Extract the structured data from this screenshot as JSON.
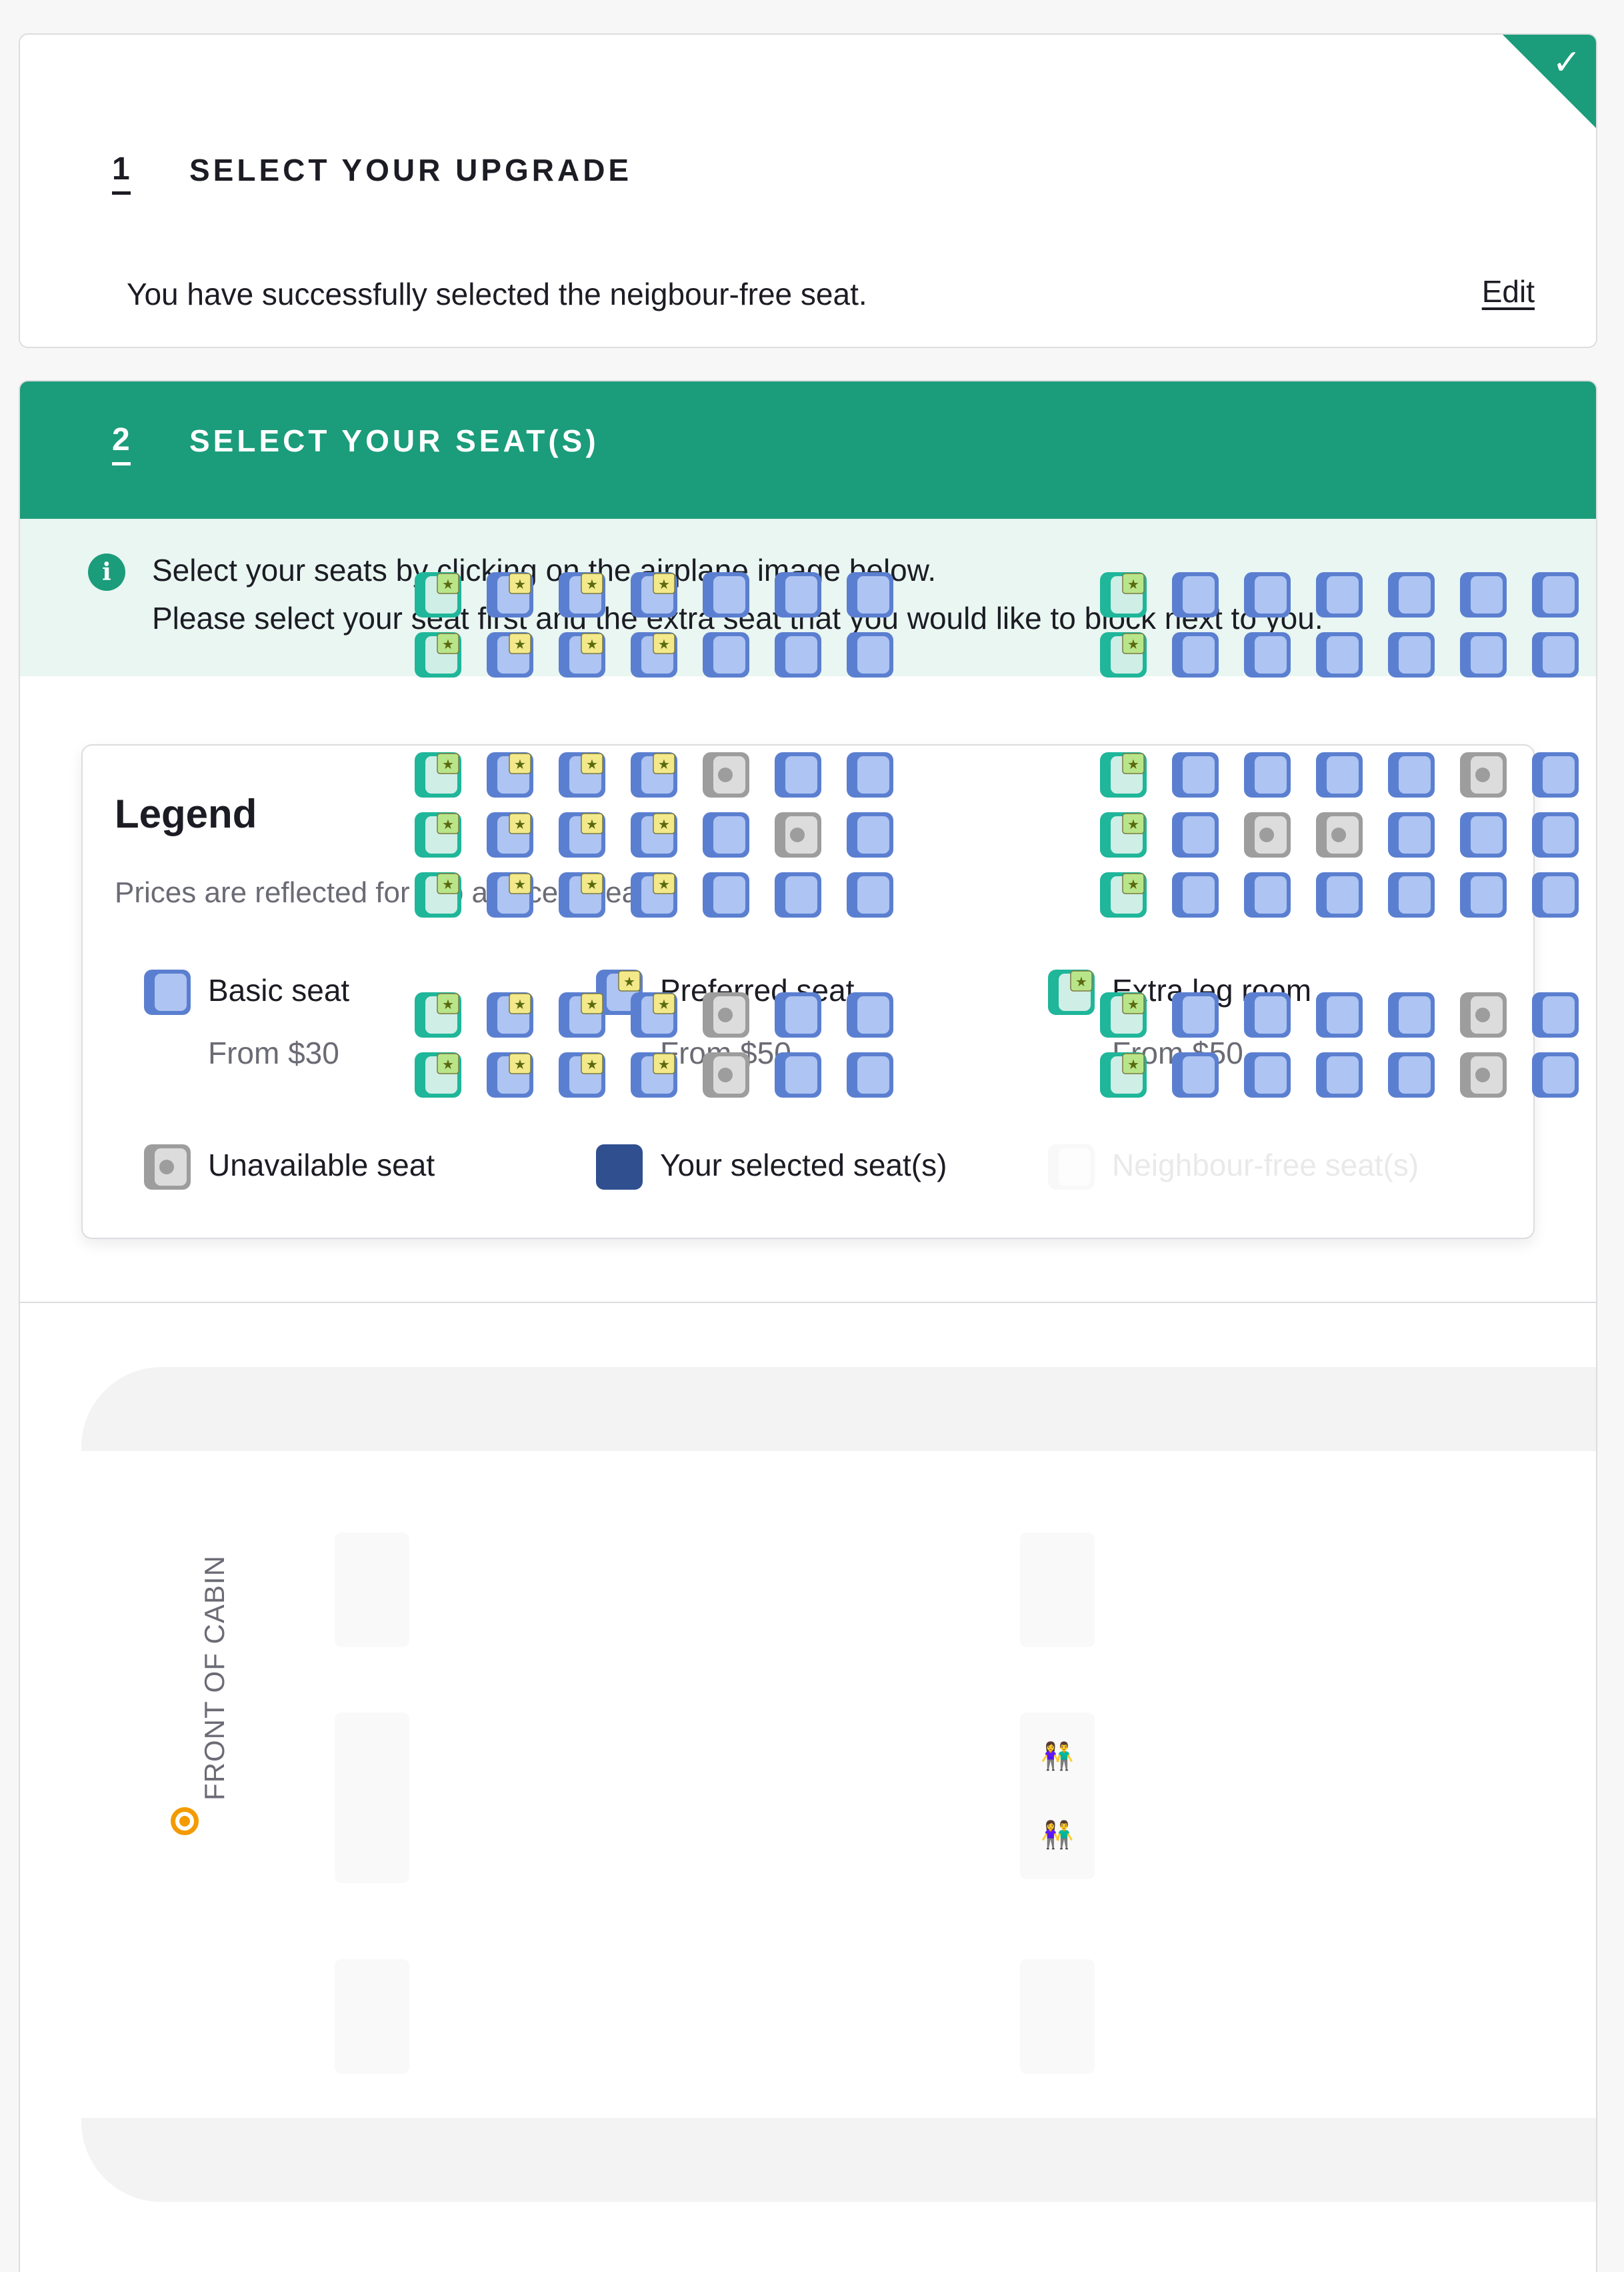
{
  "step1": {
    "number": "1",
    "title": "SELECT YOUR UPGRADE",
    "message": "You have successfully selected the neigbour-free seat.",
    "edit_label": "Edit",
    "status_icon": "check-icon"
  },
  "step2": {
    "number": "2",
    "title": "SELECT YOUR SEAT(S)",
    "info_icon": "info-icon",
    "info_line1": "Select your seats by clicking on the airplane image below.",
    "info_line2": "Please select your seat first and the extra seat that you would like to block next to you."
  },
  "legend": {
    "title": "Legend",
    "note": "Prices are reflected for two adjacent seats.",
    "items": [
      {
        "type": "basic",
        "label": "Basic seat",
        "price": "From $30"
      },
      {
        "type": "preferred",
        "label": "Preferred seat",
        "price": "From $50"
      },
      {
        "type": "extra",
        "label": "Extra leg room",
        "price": "From $50"
      },
      {
        "type": "unavailable",
        "label": "Unavailable seat",
        "price": ""
      },
      {
        "type": "selected",
        "label": "Your selected seat(s)",
        "price": ""
      },
      {
        "type": "neighbour",
        "label": "Neighbour-free seat(s)",
        "price": ""
      }
    ]
  },
  "cabin": {
    "front_label": "FRONT OF CABIN",
    "lavatory_icon": "lavatory-icon",
    "colors": {
      "basic": "#5b7fd0",
      "basic_light": "#aec4f2",
      "preferred_badge": "#f3e98a",
      "extra_teal": "#1fb69a",
      "extra_light": "#cfeee6",
      "extra_badge": "#b9e58a",
      "unavailable": "#9d9d9d",
      "unavailable_light": "#dcdcdc",
      "selected": "#2f4f8f"
    },
    "left_section": [
      [
        "E",
        "P",
        "P",
        "P",
        "B",
        "B",
        "B"
      ],
      [
        "E",
        "P",
        "P",
        "P",
        "B",
        "B",
        "B"
      ],
      [
        "E",
        "P",
        "P",
        "P",
        "U",
        "B",
        "B"
      ],
      [
        "E",
        "P",
        "P",
        "P",
        "B",
        "U",
        "B"
      ],
      [
        "E",
        "P",
        "P",
        "P",
        "B",
        "B",
        "B"
      ],
      [
        "E",
        "P",
        "P",
        "P",
        "U",
        "B",
        "B"
      ],
      [
        "E",
        "P",
        "P",
        "P",
        "U",
        "B",
        "B"
      ]
    ],
    "right_section": [
      [
        "E",
        "B",
        "B",
        "B",
        "B",
        "B",
        "B",
        "B"
      ],
      [
        "E",
        "B",
        "B",
        "B",
        "B",
        "B",
        "B",
        "B"
      ],
      [
        "E",
        "B",
        "B",
        "B",
        "B",
        "U",
        "B",
        "B"
      ],
      [
        "E",
        "B",
        "U",
        "U",
        "B",
        "B",
        "B",
        "B"
      ],
      [
        "E",
        "B",
        "B",
        "B",
        "B",
        "B",
        "B",
        "B"
      ],
      [
        "E",
        "B",
        "B",
        "B",
        "B",
        "U",
        "B",
        "B"
      ],
      [
        "E",
        "B",
        "B",
        "B",
        "B",
        "U",
        "B",
        "B"
      ]
    ]
  }
}
